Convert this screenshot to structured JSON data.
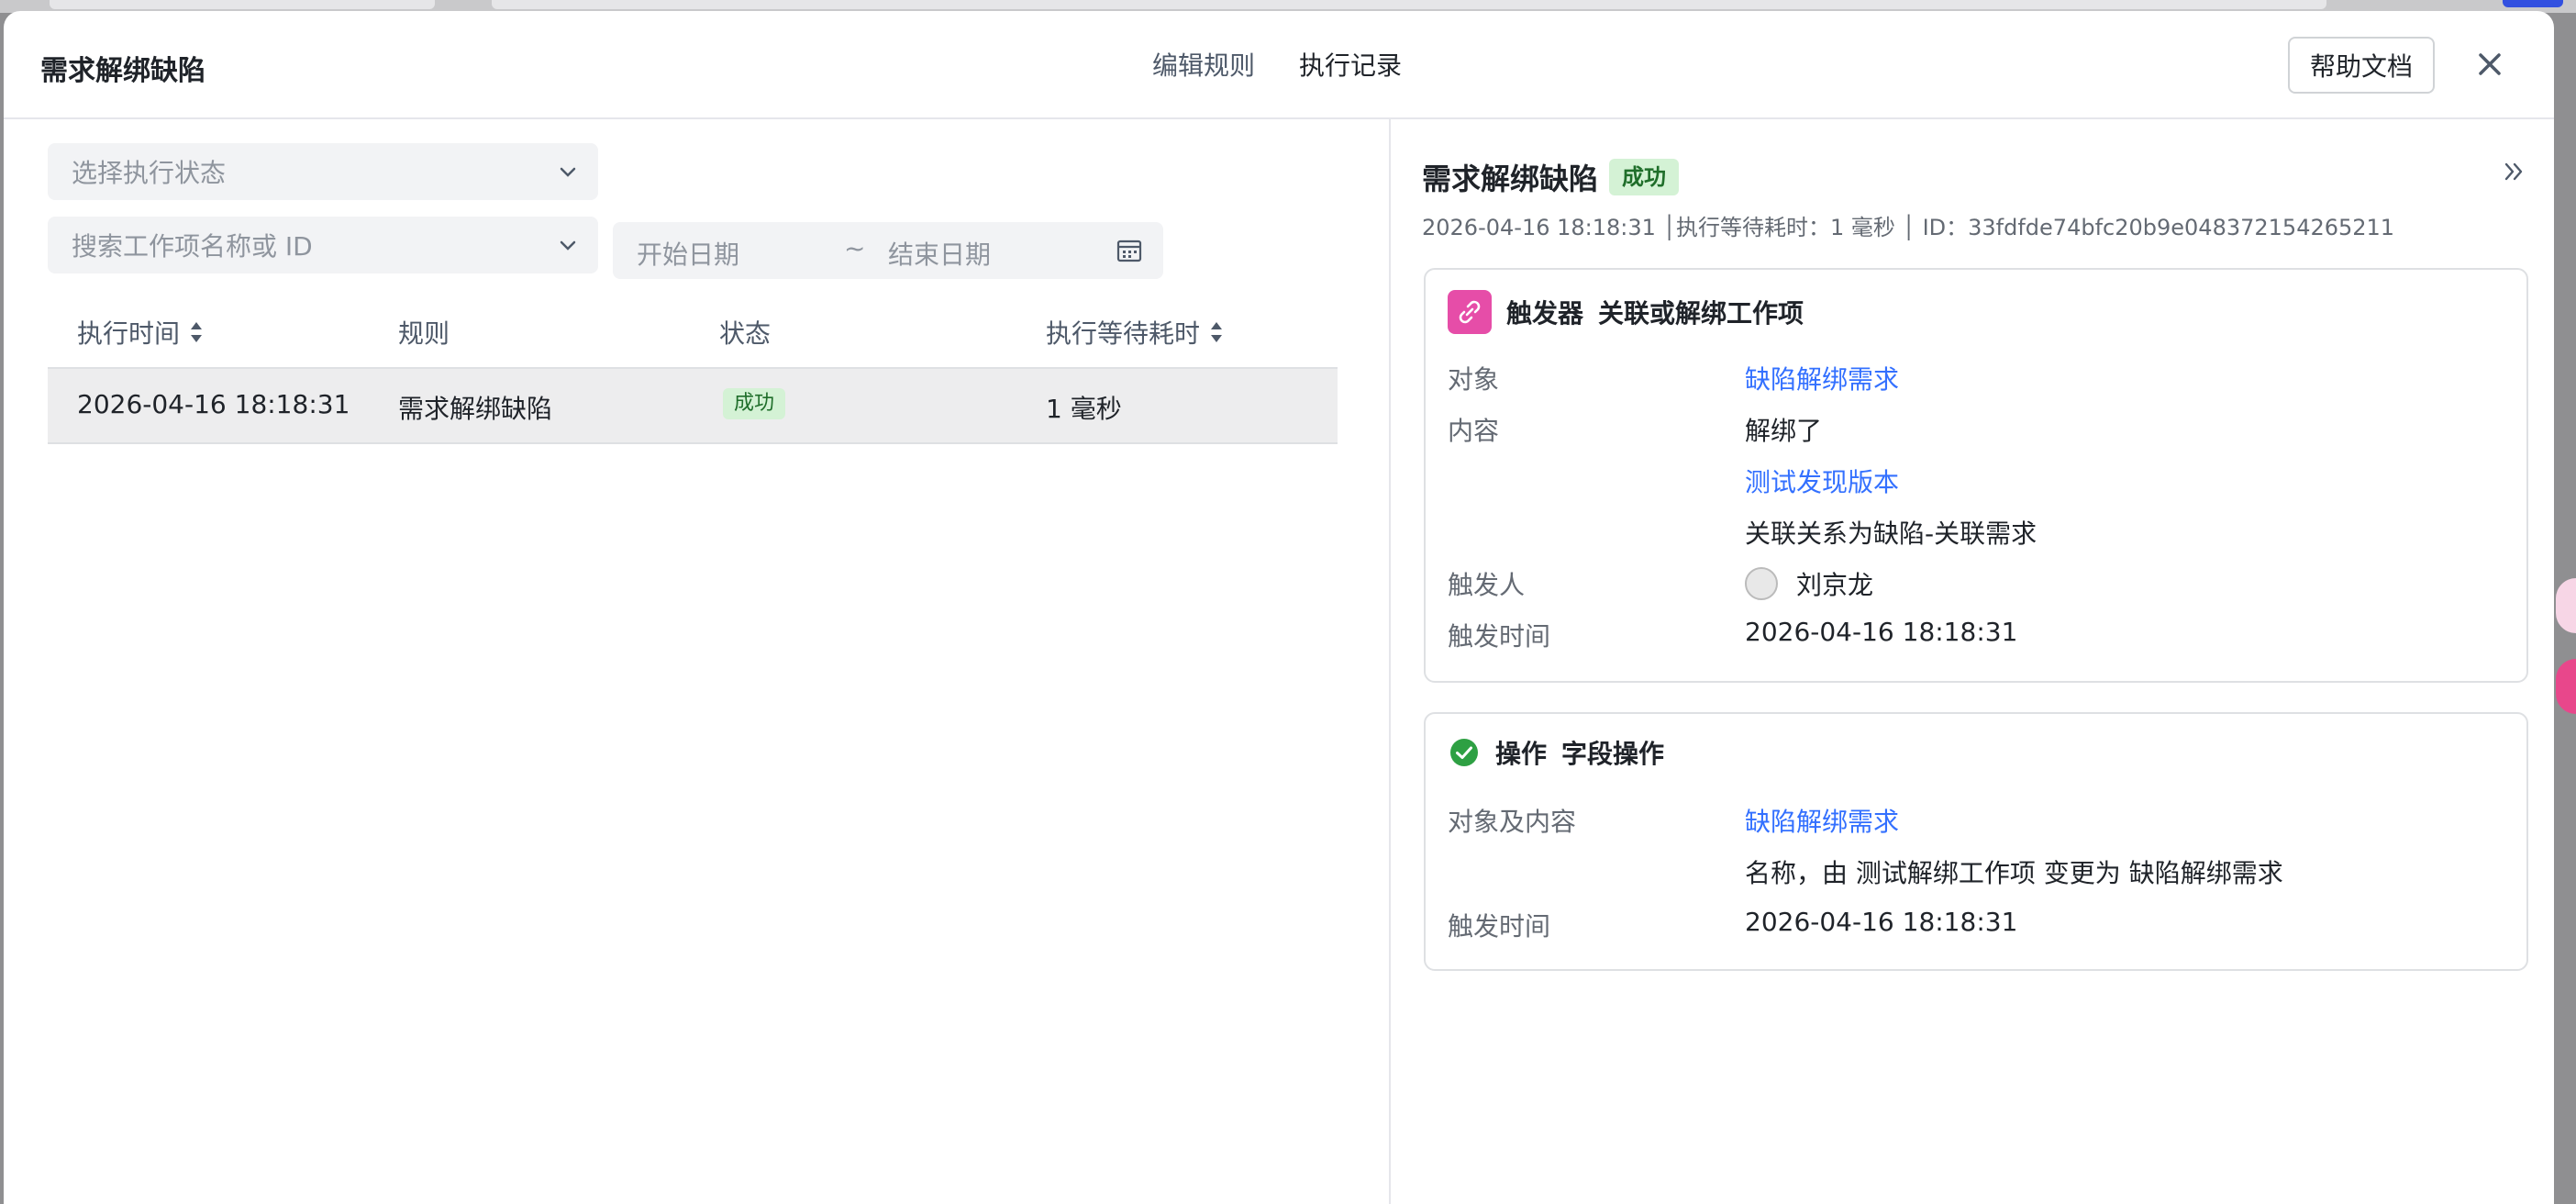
{
  "modal": {
    "title": "需求解绑缺陷"
  },
  "tabs": [
    {
      "label": "编辑规则"
    },
    {
      "label": "执行记录"
    }
  ],
  "help_button": "帮助文档",
  "filters": {
    "status_placeholder": "选择执行状态",
    "search_placeholder": "搜索工作项名称或 ID",
    "start_date_placeholder": "开始日期",
    "separator": "~",
    "end_date_placeholder": "结束日期"
  },
  "table": {
    "columns": [
      "执行时间",
      "规则",
      "状态",
      "执行等待耗时"
    ],
    "rows": [
      {
        "time": "2026-04-16 18:18:31",
        "rule": "需求解绑缺陷",
        "status": "成功",
        "wait": "1 毫秒"
      }
    ]
  },
  "detail": {
    "title": "需求解绑缺陷",
    "status": "成功",
    "meta": "2026-04-16 18:18:31 │执行等待耗时：1 毫秒 │ ID：33fdfde74bfc20b9e048372154265211",
    "trigger": {
      "type": "触发器",
      "name": "关联或解绑工作项",
      "object_label": "对象",
      "object_value": "缺陷解绑需求",
      "content_label": "内容",
      "content_line1": "解绑了",
      "content_line2": "测试发现版本",
      "content_line3": "关联关系为缺陷-关联需求",
      "trigger_person_label": "触发人",
      "trigger_person": "刘京龙",
      "trigger_time_label": "触发时间",
      "trigger_time": "2026-04-16 18:18:31"
    },
    "action": {
      "type": "操作",
      "name": "字段操作",
      "object_content_label": "对象及内容",
      "object_value": "缺陷解绑需求",
      "change_text": "名称，由 测试解绑工作项 变更为 缺陷解绑需求",
      "trigger_time_label": "触发时间",
      "trigger_time": "2026-04-16 18:18:31"
    }
  },
  "colors": {
    "link": "#3370ff",
    "success_bg": "#d4f2d5",
    "success_text": "#1f6e2a",
    "trigger_icon_bg": "#e64da8",
    "check_green": "#2ea043"
  },
  "icons": [
    "chevron-down-icon",
    "calendar-icon",
    "sort-icon",
    "close-icon",
    "double-chevron-right-icon",
    "link-icon",
    "check-circle-icon",
    "avatar-icon"
  ]
}
